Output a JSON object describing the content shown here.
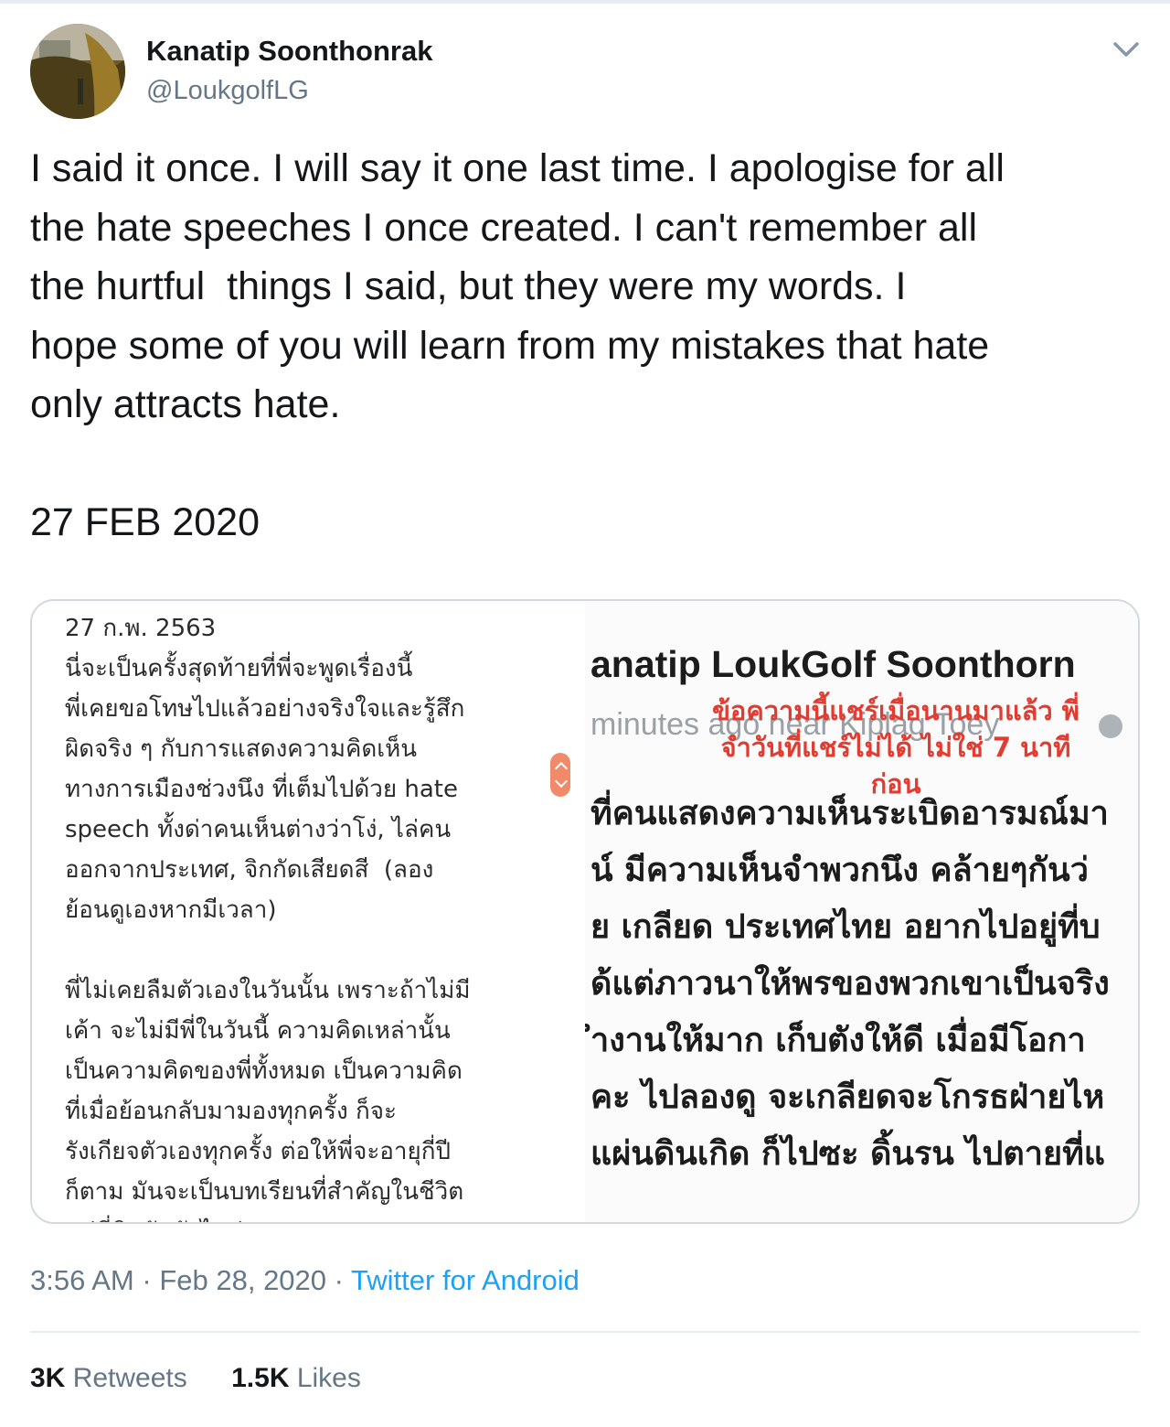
{
  "tweet": {
    "author": {
      "display_name": "Kanatip Soonthonrak",
      "handle": "@LoukgolfLG"
    },
    "text": "I said it once. I will say it one last time. I apologise for all\nthe hate speeches I once created. I can't remember all\nthe hurtful  things I said, but they were my words. I\nhope some of you will learn from my mistakes that hate\nonly attracts hate.\n\n27 FEB 2020",
    "time": "3:56 AM",
    "date": "Feb 28, 2020",
    "separator": "·",
    "source": "Twitter for Android",
    "stats": {
      "retweets_count": "3K",
      "retweets_label": "Retweets",
      "likes_count": "1.5K",
      "likes_label": "Likes"
    }
  },
  "media": {
    "left_note": {
      "date": "27 ก.พ. 2563",
      "paragraph1": "นี่จะเป็นครั้งสุดท้ายที่พี่จะพูดเรื่องนี้\nพี่เคยขอโทษไปแล้วอย่างจริงใจและรู้สึก\nผิดจริง ๆ กับการแสดงความคิดเห็น\nทางการเมืองช่วงนึง ที่เต็มไปด้วย hate\nspeech ทั้งด่าคนเห็นต่างว่าโง่, ไล่คน\nออกจากประเทศ, จิกกัดเสียดสี  (ลอง\nย้อนดูเองหากมีเวลา)",
      "paragraph2": "พี่ไม่เคยลืมตัวเองในวันนั้น เพราะถ้าไม่มี\nเค้า จะไม่มีพี่ในวันนี้ ความคิดเหล่านั้น\nเป็นความคิดของพี่ทั้งหมด เป็นความคิด\nที่เมื่อย้อนกลับมามองทุกครั้ง ก็จะ\nรังเกียจตัวเองทุกครั้ง ต่อให้พี่จะอายุกี่ปี\nก็ตาม มันจะเป็นบทเรียนที่สำคัญในชีวิต\nแต่พี่ติดกับตัวไปต่อ"
    },
    "right_post": {
      "name": "anatip LoukGolf Soonthorn",
      "meta": "minutes ago near Kiplag Toey",
      "stamp": "ข้อความนี้แชร์เมื่อนานมาแล้ว พี่\nจำวันที่แชร์ไม่ได้ ไม่ใช่ 7 นาที\nก่อน",
      "lines": [
        "ที่คนแสดงความเห็นระเบิดอารมณ์มา",
        "น์ มีความเห็นจำพวกนึง คล้ายๆกันว่",
        "ย เกลียด ประเทศไทย อยากไปอยู่ที่บ",
        "ด้แต่ภาวนาให้พรของพวกเขาเป็นจริง",
        "ำงานให้มาก เก็บตังให้ดี เมื่อมีโอกา",
        "คะ ไปลองดู จะเกลียดจะโกรธฝ่ายไห",
        "แผ่นดินเกิด ก็ไปซะ ดิ้นรน ไปตายที่แ"
      ]
    }
  },
  "colors": {
    "text": "#14171a",
    "secondary": "#657786",
    "link": "#1da1f2",
    "stamp_red": "#e03c31",
    "border": "#cfd9de"
  },
  "icons": {
    "caret": "chevron-down-icon",
    "globe": "globe-icon"
  }
}
